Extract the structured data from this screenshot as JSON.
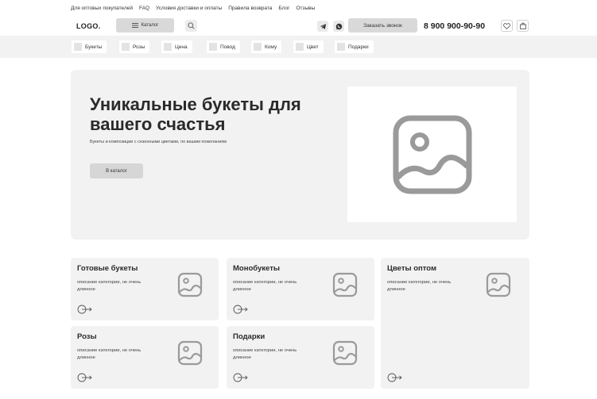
{
  "top_links": [
    "Для оптовых покупателей",
    "FAQ",
    "Условия доставки и оплаты",
    "Правила возврата",
    "Блог",
    "Отзывы"
  ],
  "header": {
    "logo": "LOGO.",
    "catalog_label": "Каталог",
    "callback_label": "Заказать звонок",
    "phone": "8 900 900-90-90"
  },
  "categories": [
    "Букеты",
    "Розы",
    "Цена",
    "Повод",
    "Кому",
    "Цвет",
    "Подарки"
  ],
  "hero": {
    "title": "Уникальные букеты для вашего счастья",
    "subtitle": "Букеты и композиции с сезонными цветами, по вашим пожеланиям",
    "button": "В каталог"
  },
  "cards": [
    {
      "title": "Готовые букеты",
      "desc": "описание категории, не очень длинное"
    },
    {
      "title": "Монобукеты",
      "desc": "описание категории, не очень длинное"
    },
    {
      "title": "Цветы оптом",
      "desc": "описание категории, не очень длинное"
    },
    {
      "title": "Розы",
      "desc": "описание категории, не очень длинное"
    },
    {
      "title": "Подарки",
      "desc": "описание категории, не очень длинное"
    }
  ],
  "icons": {
    "catalog": "list-icon",
    "search": "search-icon",
    "telegram": "telegram-icon",
    "whatsapp": "whatsapp-icon",
    "favorites": "heart-icon",
    "cart": "bag-icon",
    "image": "image-placeholder-icon",
    "arrow": "arrow-right-icon"
  }
}
